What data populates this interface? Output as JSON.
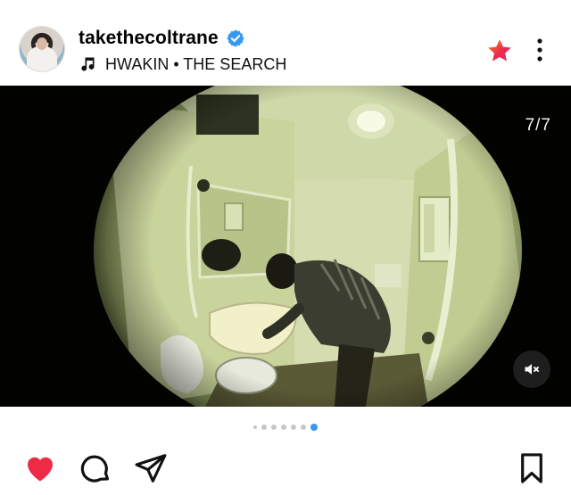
{
  "post": {
    "username": "takethecoltrane",
    "verified": true,
    "audio": "HWAKIN • THE SEARCH",
    "slide_counter": "7/7",
    "total_slides": 7,
    "current_slide": 7
  },
  "icons": {
    "verified": "verified-badge-icon",
    "music": "music-note-icon",
    "favorite": "star-icon",
    "more": "more-vertical-icon",
    "mute": "speaker-muted-icon",
    "like": "heart-icon",
    "comment": "comment-bubble-icon",
    "share": "paper-plane-icon",
    "save": "bookmark-icon"
  },
  "colors": {
    "like_active": "#ee2a47",
    "verified": "#3897f0",
    "dot_active": "#3897f0",
    "dot_inactive": "#c7c7c7",
    "star_gradient_start": "#f58529",
    "star_gradient_end": "#dd2a7b"
  }
}
